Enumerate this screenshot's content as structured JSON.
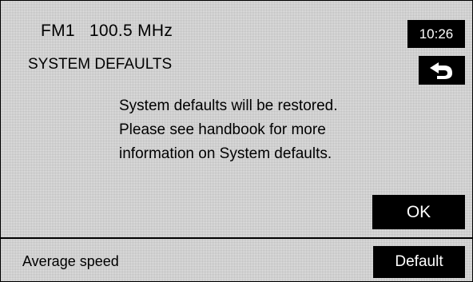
{
  "status_bar": {
    "band": "FM1",
    "frequency": "100.5 MHz",
    "clock": "10:26"
  },
  "screen": {
    "title": "SYSTEM DEFAULTS",
    "back_icon": "back-arrow-icon"
  },
  "dialog": {
    "lines": [
      "System defaults will be restored.",
      "Please see handbook for more",
      "information on System defaults."
    ],
    "ok_label": "OK"
  },
  "footer": {
    "label": "Average speed",
    "button_label": "Default"
  },
  "colors": {
    "background": "#e4e4e4",
    "button_bg": "#000000",
    "button_text": "#ffffff",
    "text": "#000000"
  }
}
